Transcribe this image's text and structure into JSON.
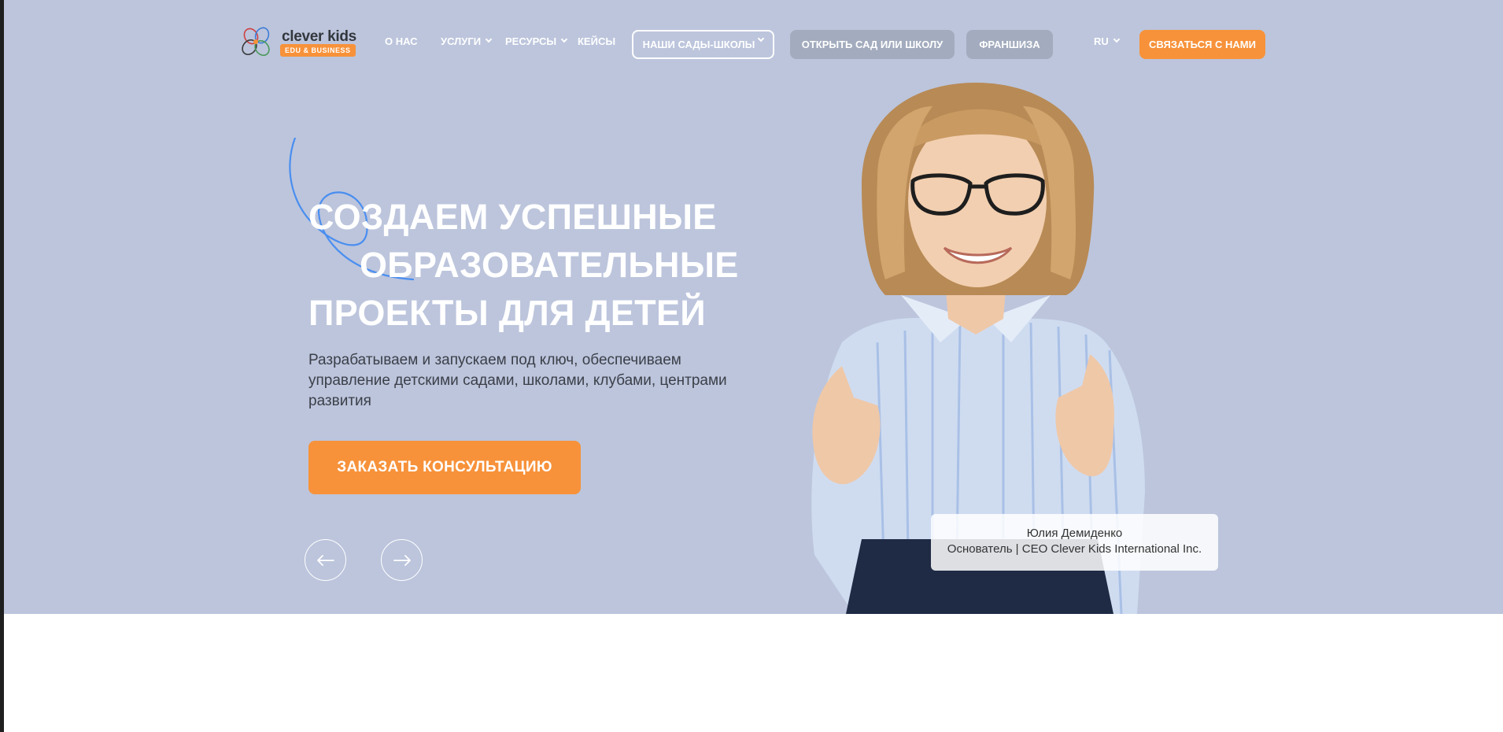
{
  "logo": {
    "name": "clever kids",
    "badge": "EDU & BUSINESS"
  },
  "nav": {
    "about": "О НАС",
    "services": "УСЛУГИ",
    "resources": "РЕСУРСЫ",
    "cases": "КЕЙСЫ",
    "our_schools": "НАШИ САДЫ-ШКОЛЫ",
    "open_school": "ОТКРЫТЬ САД ИЛИ ШКОЛУ",
    "franchise": "ФРАНШИЗА",
    "language": "RU",
    "contact": "СВЯЗАТЬСЯ С НАМИ"
  },
  "hero": {
    "title_line1": "СОЗДАЕМ УСПЕШНЫЕ",
    "title_line2": "ОБРАЗОВАТЕЛЬНЫЕ",
    "title_line3": "ПРОЕКТЫ ДЛЯ ДЕТЕЙ",
    "subtitle": "Разрабатываем и запускаем под ключ, обеспечиваем управление детскими садами, школами, клубами, центрами развития",
    "cta": "ЗАКАЗАТЬ КОНСУЛЬТАЦИЮ"
  },
  "caption": {
    "name": "Юлия Демиденко",
    "role": "Основатель | CEO Clever Kids International Inc."
  },
  "colors": {
    "hero_bg": "#bcc5dc",
    "accent": "#f7923a",
    "grey_pill": "#a3acbe"
  }
}
